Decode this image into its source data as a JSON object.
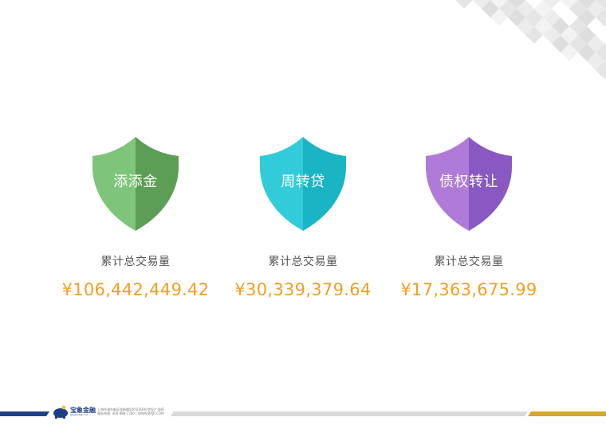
{
  "colors": {
    "green_light": "#7ec47a",
    "green_dark": "#5c9e55",
    "cyan_light": "#32cbd9",
    "cyan_dark": "#1ab5c4",
    "purple_light": "#b07ad9",
    "purple_dark": "#8a58c2",
    "value_orange": "#f0a023",
    "footer_navy": "#1e3f86",
    "footer_gold": "#d6a82c"
  },
  "products": [
    {
      "name": "添添金",
      "metric_label": "累计总交易量",
      "value": "¥106,442,449.42"
    },
    {
      "name": "周转贷",
      "metric_label": "累计总交易量",
      "value": "¥30,339,379.64"
    },
    {
      "name": "债权转让",
      "metric_label": "累计总交易量",
      "value": "¥17,363,675.99"
    }
  ],
  "footer": {
    "logo_text": "宝象金融",
    "logo_sub": "www.baojr.com",
    "address_line": "上海市浦东新区张杨路500号SOHO世纪广场6F",
    "contact_line": "服务热线: 400-888-1780 | WWW.BXJR.COM"
  }
}
